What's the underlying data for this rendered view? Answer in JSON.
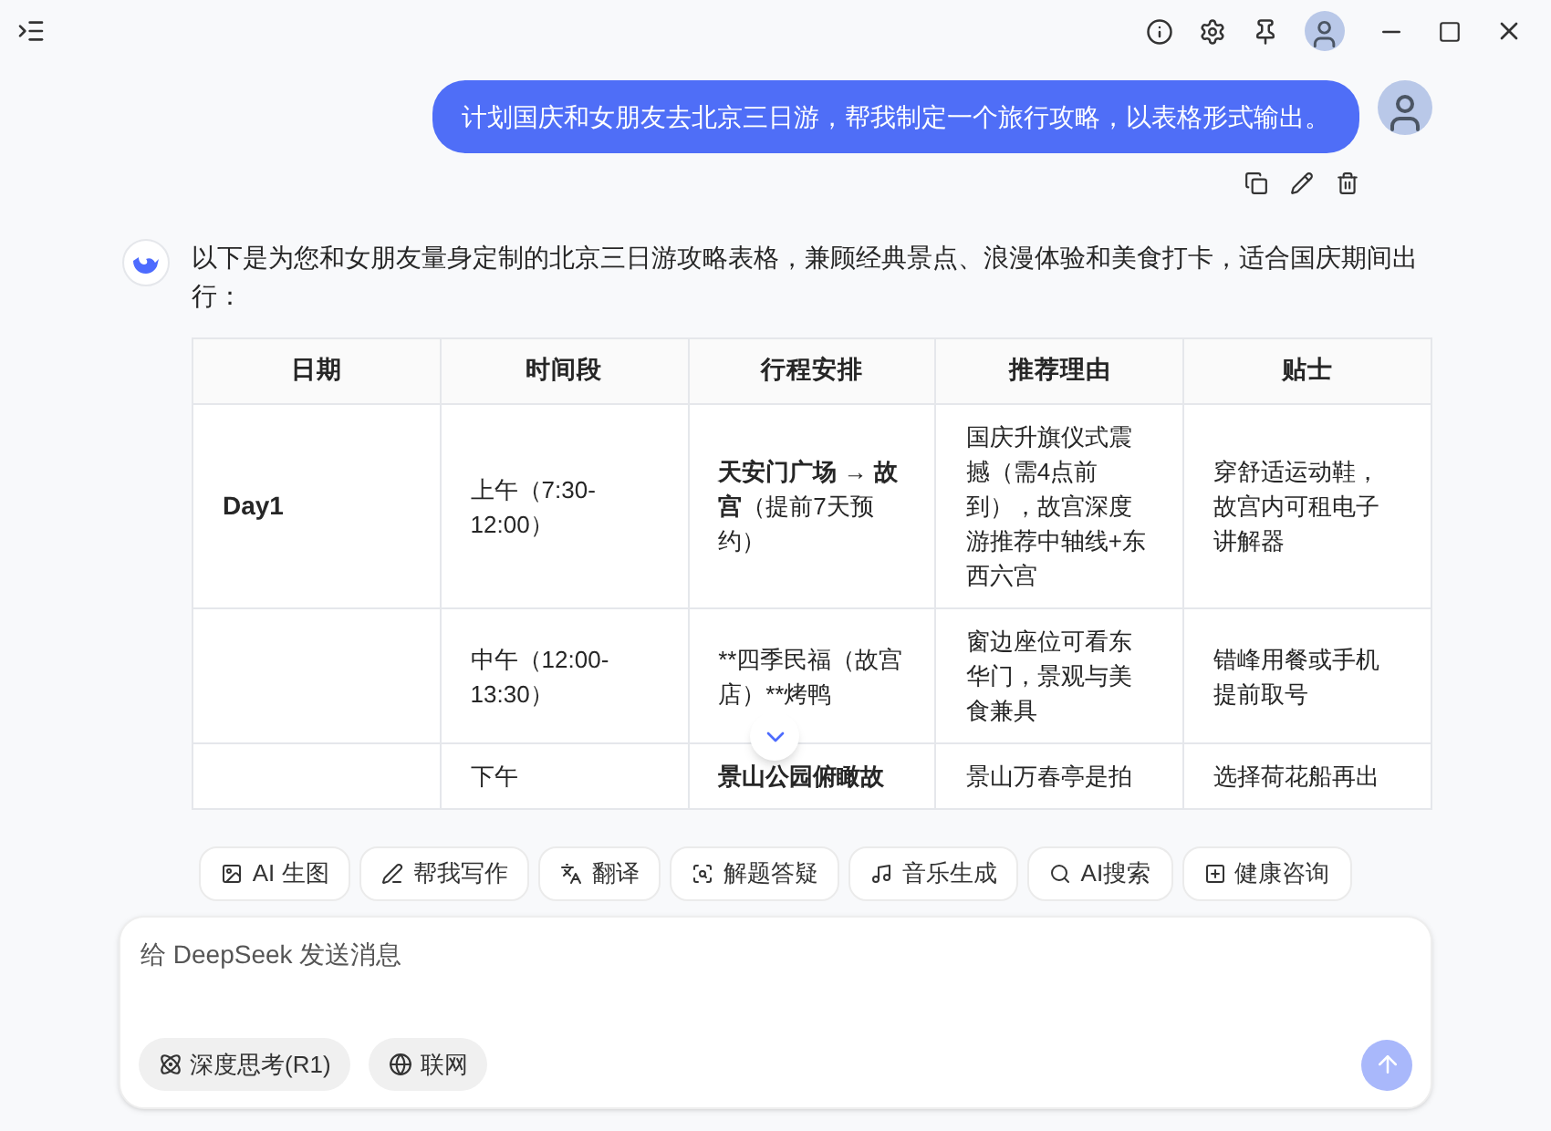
{
  "user_message": {
    "text": "计划国庆和女朋友去北京三日游，帮我制定一个旅行攻略，以表格形式输出。"
  },
  "assistant_message": {
    "intro": "以下是为您和女朋友量身定制的北京三日游攻略表格，兼顾经典景点、浪漫体验和美食打卡，适合国庆期间出行：",
    "table": {
      "columns": [
        "日期",
        "时间段",
        "行程安排",
        "推荐理由",
        "贴士"
      ],
      "rows": [
        {
          "date": "Day1",
          "time": "上午（7:30-12:00）",
          "plan": [
            {
              "text": "天安门广场 → 故宫",
              "bold": true
            },
            {
              "text": "（提前7天预约）",
              "bold": false
            }
          ],
          "reason": "国庆升旗仪式震撼（需4点前到），故宫深度游推荐中轴线+东西六宫",
          "tip": "穿舒适运动鞋，故宫内可租电子讲解器"
        },
        {
          "time": "中午（12:00-13:30）",
          "plan": [
            {
              "text": "**四季民福（故宫店）**烤鸭",
              "bold": false
            }
          ],
          "reason": "窗边座位可看东华门，景观与美食兼具",
          "tip": "错峰用餐或手机提前取号"
        },
        {
          "time": "下午",
          "plan": [
            {
              "text": "景山公园俯瞰故",
              "bold": true
            }
          ],
          "reason": "景山万春亭是拍",
          "tip": "选择荷花船再出"
        }
      ]
    }
  },
  "chips": [
    {
      "label": "AI 生图"
    },
    {
      "label": "帮我写作"
    },
    {
      "label": "翻译"
    },
    {
      "label": "解题答疑"
    },
    {
      "label": "音乐生成"
    },
    {
      "label": "AI搜索"
    },
    {
      "label": "健康咨询"
    }
  ],
  "composer": {
    "placeholder": "给 DeepSeek 发送消息",
    "toggles": [
      {
        "label": "深度思考(R1)",
        "on": false
      },
      {
        "label": "联网",
        "on": false
      }
    ]
  }
}
